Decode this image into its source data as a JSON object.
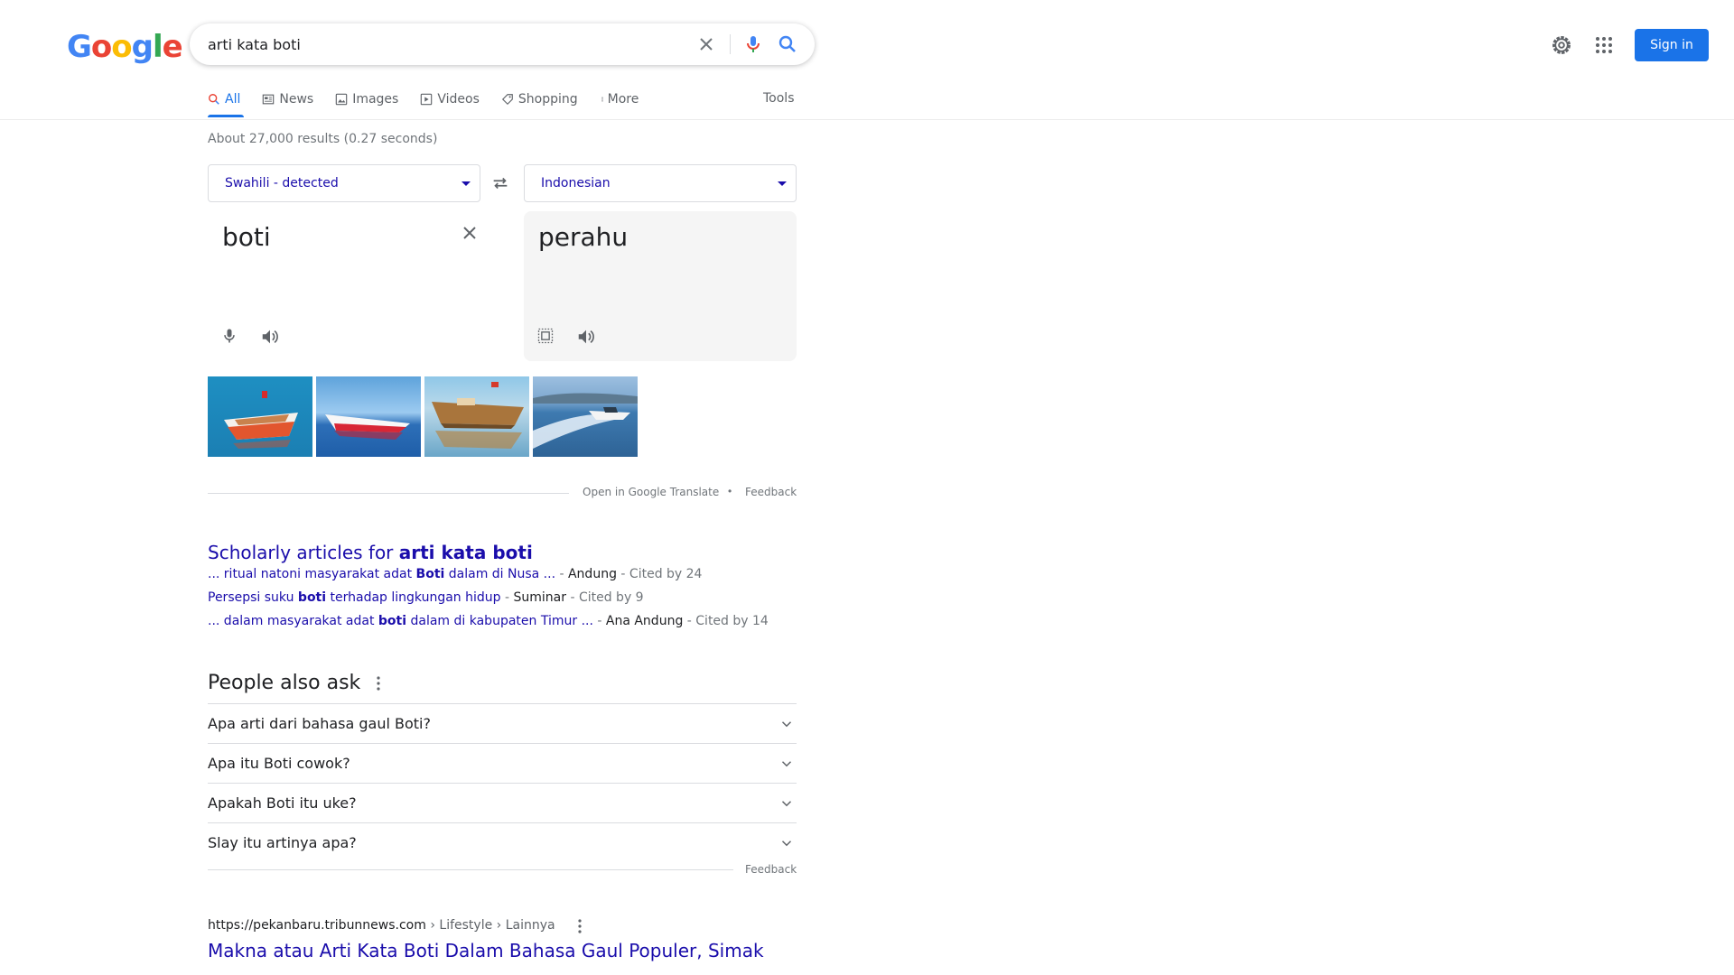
{
  "logo": {
    "letters": [
      "G",
      "o",
      "o",
      "g",
      "l",
      "e"
    ]
  },
  "search": {
    "query": "arti kata boti",
    "signin_label": "Sign in"
  },
  "tabs": [
    {
      "label": "All",
      "icon": "search-icon",
      "active": true
    },
    {
      "label": "News",
      "icon": "news-icon"
    },
    {
      "label": "Images",
      "icon": "image-icon"
    },
    {
      "label": "Videos",
      "icon": "video-icon"
    },
    {
      "label": "Shopping",
      "icon": "tag-icon"
    },
    {
      "label": "More",
      "icon": "dots-vertical-icon"
    }
  ],
  "tools_label": "Tools",
  "result_stats": "About 27,000 results (0.27 seconds)",
  "translate": {
    "source_lang": "Swahili - detected",
    "target_lang": "Indonesian",
    "source_text": "boti",
    "target_text": "perahu",
    "open_label": "Open in Google Translate",
    "bullet": "•",
    "feedback_label": "Feedback"
  },
  "scholar": {
    "title_prefix": "Scholarly articles for ",
    "title_bold": "arti kata boti",
    "rows": [
      {
        "pre": "... ritual natoni masyarakat adat ",
        "bold": "Boti",
        "post": " dalam di Nusa ...",
        "author": "Andung",
        "cited": "Cited by 24"
      },
      {
        "pre": "Persepsi suku ",
        "bold": "boti",
        "post": " terhadap lingkungan hidup",
        "author": "Suminar",
        "cited": "Cited by 9"
      },
      {
        "pre": "... dalam masyarakat adat ",
        "bold": "boti",
        "post": " dalam di kabupaten Timur ...",
        "author": "Ana Andung",
        "cited": "Cited by 14"
      }
    ],
    "sep": " - "
  },
  "paa": {
    "title": "People also ask",
    "questions": [
      "Apa arti dari bahasa gaul Boti?",
      "Apa itu Boti cowok?",
      "Apakah Boti itu uke?",
      "Slay itu artinya apa?"
    ],
    "feedback_label": "Feedback"
  },
  "result": {
    "url_domain": "https://pekanbaru.tribunnews.com",
    "url_path": " › Lifestyle › Lainnya",
    "title": "Makna atau Arti Kata Boti Dalam Bahasa Gaul Populer, Simak ..."
  },
  "colors": {
    "accent": "#1a73e8",
    "link": "#1a0dab",
    "muted": "#70757a"
  }
}
